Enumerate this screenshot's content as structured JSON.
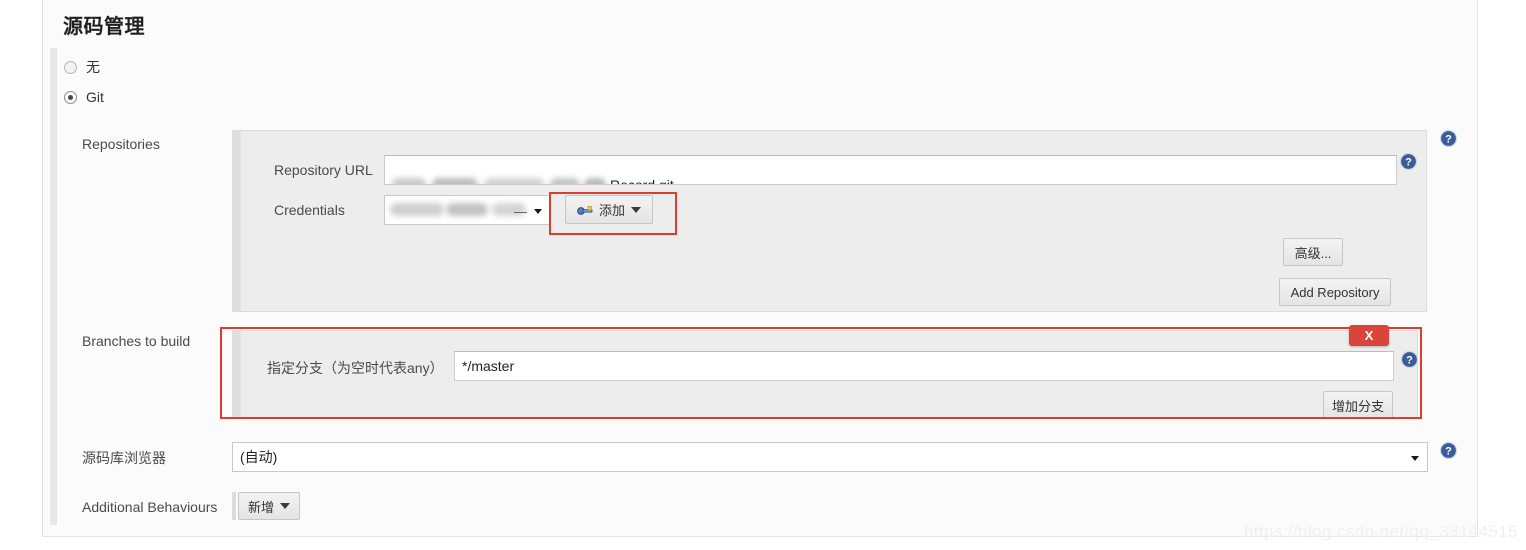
{
  "page": {
    "title": "源码管理",
    "watermark": "https://blog.csdn.net/qq_33144515"
  },
  "scm_options": [
    {
      "label": "无",
      "selected": false
    },
    {
      "label": "Git",
      "selected": true
    }
  ],
  "repositories": {
    "section_label": "Repositories",
    "repository_url": {
      "label": "Repository URL",
      "value": "Record.git",
      "redacted": true
    },
    "credentials": {
      "label": "Credentials",
      "value": "",
      "redacted": true
    },
    "add_credentials_button": "添加",
    "advanced_button": "高级...",
    "add_repository_button": "Add Repository"
  },
  "branches": {
    "section_label": "Branches to build",
    "branch_specifier": {
      "label": "指定分支（为空时代表any）",
      "value": "*/master"
    },
    "add_branch_button": "增加分支",
    "delete_badge": "X"
  },
  "repository_browser": {
    "label": "源码库浏览器",
    "value": "(自动)"
  },
  "additional_behaviours": {
    "label": "Additional Behaviours",
    "add_button": "新增"
  },
  "colors": {
    "highlight": "#e03b2f",
    "delete_badge": "#d9453b",
    "help_icon": "#3b5c96",
    "panel_bg": "#eeeeee"
  }
}
